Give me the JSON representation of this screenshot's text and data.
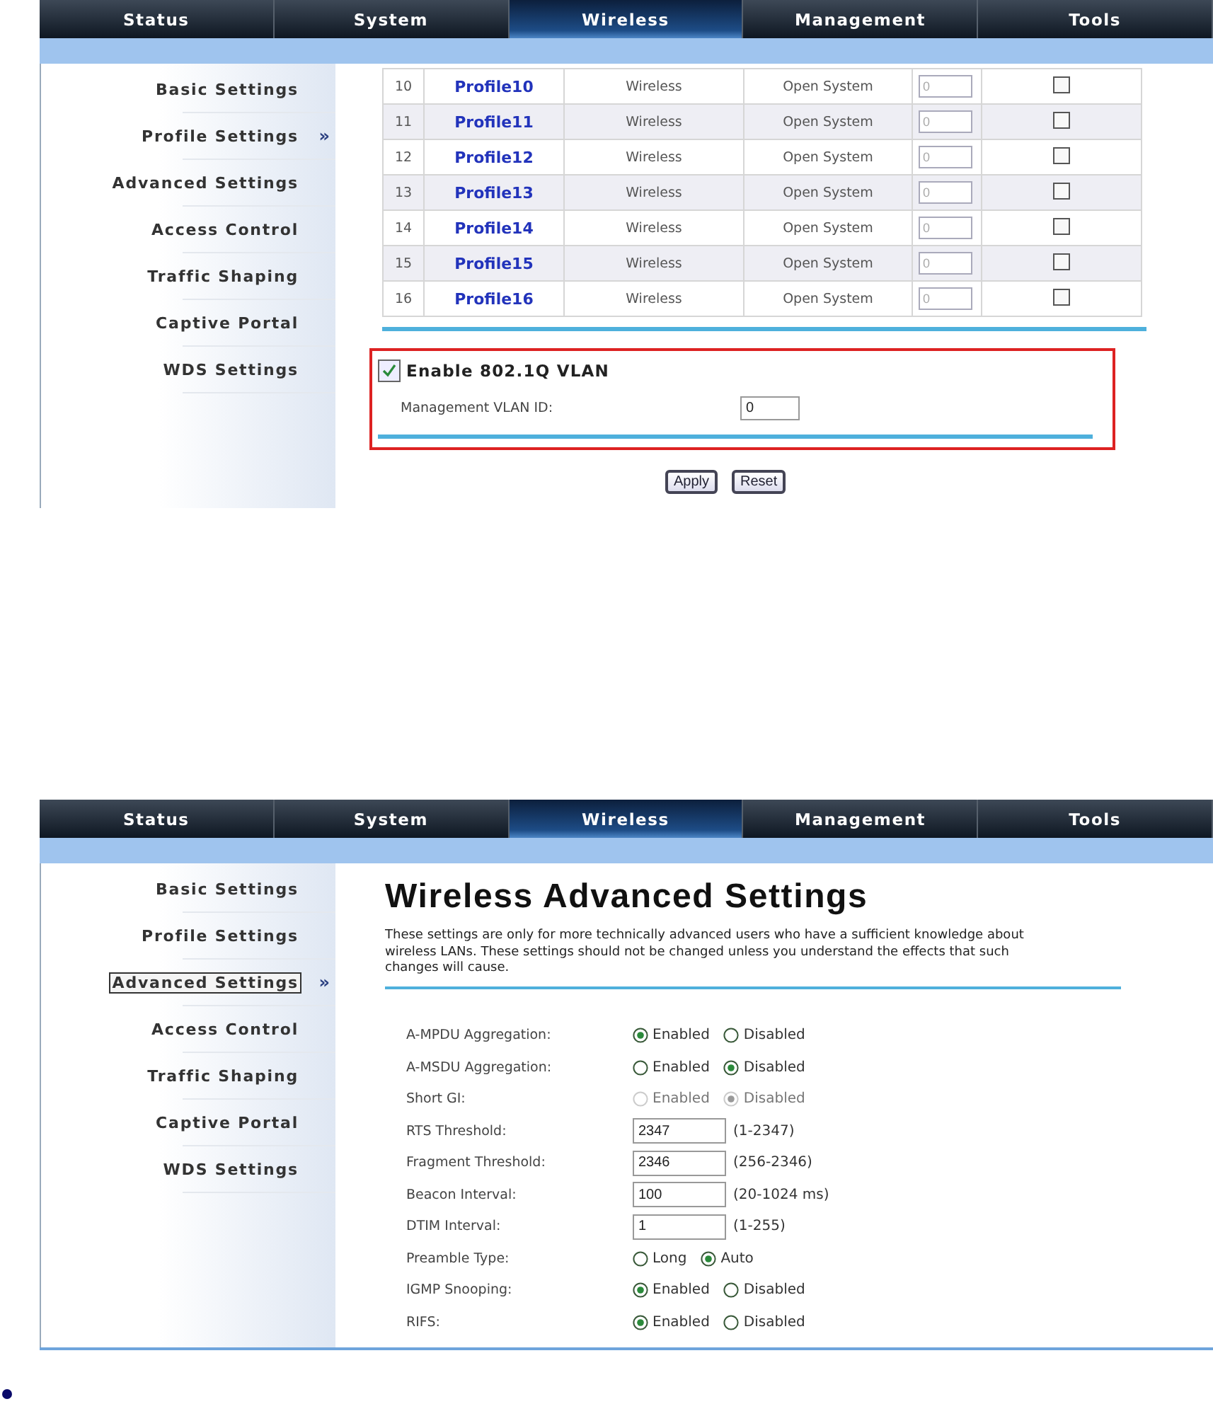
{
  "screens": [
    {
      "kind": "profiles",
      "nav": [
        {
          "label": "Status",
          "selected": false
        },
        {
          "label": "System",
          "selected": false
        },
        {
          "label": "Wireless",
          "selected": true
        },
        {
          "label": "Management",
          "selected": false
        },
        {
          "label": "Tools",
          "selected": false
        }
      ],
      "sidebar": {
        "marker": "»",
        "items": [
          {
            "label": "Basic Settings",
            "selected": false,
            "focused": false
          },
          {
            "label": "Profile Settings",
            "selected": true,
            "focused": false
          },
          {
            "label": "Advanced Settings",
            "selected": false,
            "focused": false
          },
          {
            "label": "Access Control",
            "selected": false,
            "focused": false
          },
          {
            "label": "Traffic Shaping",
            "selected": false,
            "focused": false
          },
          {
            "label": "Captive Portal",
            "selected": false,
            "focused": false
          },
          {
            "label": "WDS Settings",
            "selected": false,
            "focused": false
          }
        ]
      },
      "table": {
        "rows": [
          {
            "number": "10",
            "name": "Profile10",
            "type": "Wireless",
            "auth": "Open System",
            "vlan": "0",
            "checked": false
          },
          {
            "number": "11",
            "name": "Profile11",
            "type": "Wireless",
            "auth": "Open System",
            "vlan": "0",
            "checked": false
          },
          {
            "number": "12",
            "name": "Profile12",
            "type": "Wireless",
            "auth": "Open System",
            "vlan": "0",
            "checked": false
          },
          {
            "number": "13",
            "name": "Profile13",
            "type": "Wireless",
            "auth": "Open System",
            "vlan": "0",
            "checked": false
          },
          {
            "number": "14",
            "name": "Profile14",
            "type": "Wireless",
            "auth": "Open System",
            "vlan": "0",
            "checked": false
          },
          {
            "number": "15",
            "name": "Profile15",
            "type": "Wireless",
            "auth": "Open System",
            "vlan": "0",
            "checked": false
          },
          {
            "number": "16",
            "name": "Profile16",
            "type": "Wireless",
            "auth": "Open System",
            "vlan": "0",
            "checked": false
          }
        ]
      },
      "vlan": {
        "label": "Enable 802.1Q VLAN",
        "checked": true,
        "field_label": "Management VLAN ID:",
        "value": "0"
      },
      "buttons": [
        "Apply",
        "Reset"
      ]
    },
    {
      "kind": "advanced",
      "nav": [
        {
          "label": "Status",
          "selected": false
        },
        {
          "label": "System",
          "selected": false
        },
        {
          "label": "Wireless",
          "selected": true
        },
        {
          "label": "Management",
          "selected": false
        },
        {
          "label": "Tools",
          "selected": false
        }
      ],
      "sidebar": {
        "marker": "»",
        "items": [
          {
            "label": "Basic Settings",
            "selected": false,
            "focused": false
          },
          {
            "label": "Profile Settings",
            "selected": false,
            "focused": false
          },
          {
            "label": "Advanced Settings",
            "selected": true,
            "focused": true
          },
          {
            "label": "Access Control",
            "selected": false,
            "focused": false
          },
          {
            "label": "Traffic Shaping",
            "selected": false,
            "focused": false
          },
          {
            "label": "Captive Portal",
            "selected": false,
            "focused": false
          },
          {
            "label": "WDS Settings",
            "selected": false,
            "focused": false
          }
        ]
      },
      "title": "Wireless Advanced Settings",
      "description": "These settings are only for more technically advanced users who have a sufficient knowledge about wireless LANs. These settings should not be changed unless you understand the effects that such changes will cause.",
      "settings": [
        {
          "kind": "radio",
          "label": "A-MPDU Aggregation:",
          "disabled": false,
          "options": [
            {
              "label": "Enabled",
              "selected": true
            },
            {
              "label": "Disabled",
              "selected": false
            }
          ]
        },
        {
          "kind": "radio",
          "label": "A-MSDU Aggregation:",
          "disabled": false,
          "options": [
            {
              "label": "Enabled",
              "selected": false
            },
            {
              "label": "Disabled",
              "selected": true
            }
          ]
        },
        {
          "kind": "radio",
          "label": "Short GI:",
          "disabled": true,
          "options": [
            {
              "label": "Enabled",
              "selected": false
            },
            {
              "label": "Disabled",
              "selected": true
            }
          ]
        },
        {
          "kind": "input",
          "label": "RTS Threshold:",
          "value": "2347",
          "hint": "(1-2347)"
        },
        {
          "kind": "input",
          "label": "Fragment Threshold:",
          "value": "2346",
          "hint": "(256-2346)"
        },
        {
          "kind": "input",
          "label": "Beacon Interval:",
          "value": "100",
          "hint": "(20-1024 ms)"
        },
        {
          "kind": "input",
          "label": "DTIM Interval:",
          "value": "1",
          "hint": "(1-255)"
        },
        {
          "kind": "radio",
          "label": "Preamble Type:",
          "disabled": false,
          "options": [
            {
              "label": "Long",
              "selected": false
            },
            {
              "label": "Auto",
              "selected": true
            }
          ]
        },
        {
          "kind": "radio",
          "label": "IGMP Snooping:",
          "disabled": false,
          "options": [
            {
              "label": "Enabled",
              "selected": true
            },
            {
              "label": "Disabled",
              "selected": false
            }
          ]
        },
        {
          "kind": "radio",
          "label": "RIFS:",
          "disabled": false,
          "options": [
            {
              "label": "Enabled",
              "selected": true
            },
            {
              "label": "Disabled",
              "selected": false
            }
          ]
        }
      ]
    }
  ]
}
